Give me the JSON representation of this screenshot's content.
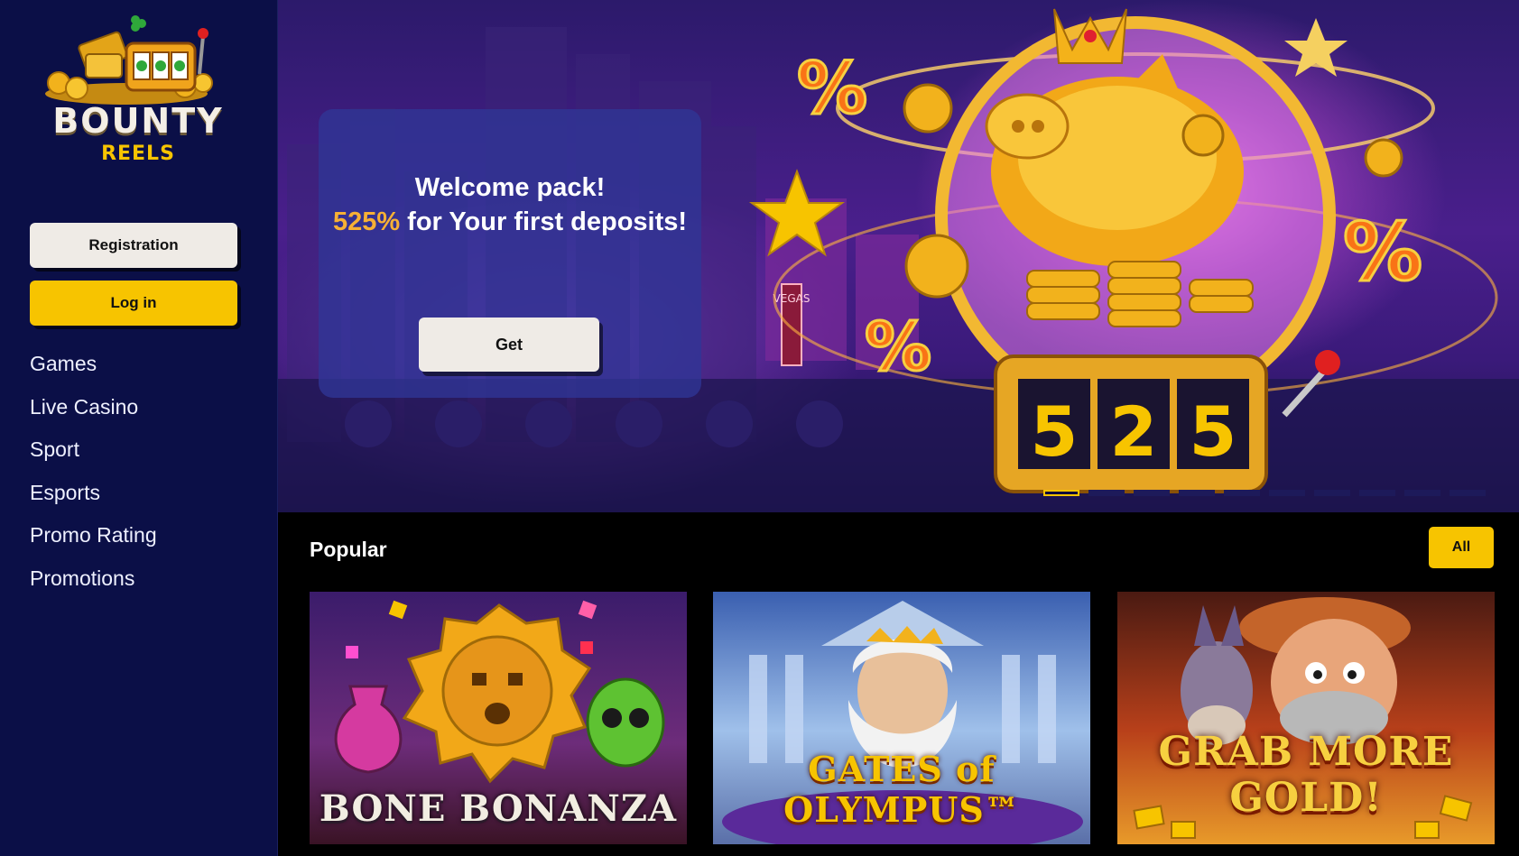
{
  "brand": {
    "name_line1": "BOUNTY",
    "name_line2": "REELS",
    "accent_color": "#f7c400",
    "sidebar_color": "#0b0f47"
  },
  "auth": {
    "registration_label": "Registration",
    "login_label": "Log in"
  },
  "nav": {
    "items": [
      {
        "label": "Games"
      },
      {
        "label": "Live Casino"
      },
      {
        "label": "Sport"
      },
      {
        "label": "Esports"
      },
      {
        "label": "Promo Rating"
      },
      {
        "label": "Promotions"
      }
    ]
  },
  "hero": {
    "title_line1": "Welcome pack!",
    "title_pct": "525%",
    "title_rest": " for Your first deposits!",
    "cta_label": "Get",
    "slot_digits": [
      "5",
      "2",
      "5"
    ],
    "sign_text": "VEGAS",
    "slide_count": 10,
    "active_slide": 1
  },
  "popular": {
    "title": "Popular",
    "all_label": "All",
    "games": [
      {
        "name": "BONE BONANZA"
      },
      {
        "name": "GATES of OLYMPUS™"
      },
      {
        "name": "GRAB MORE GOLD!"
      }
    ]
  }
}
